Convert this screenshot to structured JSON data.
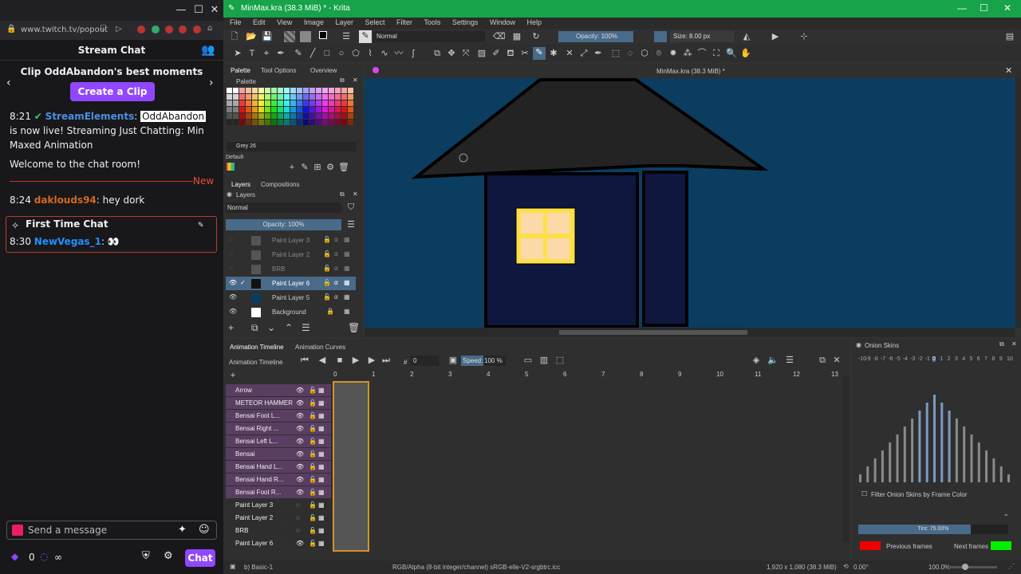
{
  "twitch": {
    "url": "www.twitch.tv/popout",
    "header": "Stream Chat",
    "clip_title": "Clip OddAbandon's best moments",
    "clip_button": "Create a Clip",
    "messages": [
      {
        "time": "8:21",
        "user": "StreamElements",
        "sep": ":",
        "mention": "OddAbandon",
        "text": "is now live! Streaming Just Chatting: Min Maxed Animation"
      },
      {
        "text": "Welcome to the chat room!"
      },
      {
        "time": "8:24",
        "user": "daklouds94",
        "text": ": hey dork"
      },
      {
        "time": "8:30",
        "user": "NewVegas_1",
        "text": ":",
        "emote": "👀"
      }
    ],
    "new_label": "New",
    "first_time": "First Time Chat",
    "input_placeholder": "Send a message",
    "points": "0",
    "chat_button": "Chat"
  },
  "krita": {
    "title": "MinMax.kra (38.3 MiB) * - Krita",
    "menu": [
      "File",
      "Edit",
      "View",
      "Image",
      "Layer",
      "Select",
      "Filter",
      "Tools",
      "Settings",
      "Window",
      "Help"
    ],
    "blend_mode": "Normal",
    "opacity": "Opacity: 100%",
    "size": "Size: 8.00 px",
    "doc_tab": "MinMax.kra (38.3 MiB) *",
    "docker_tabs": [
      "Palette",
      "Tool Options",
      "Overview"
    ],
    "palette_label": "Palette",
    "color_name": "Grey 26",
    "palette_default": "Default",
    "layers_tabs": [
      "Layers",
      "Compositions"
    ],
    "layer_mode": "Normal",
    "layer_opacity": "Opacity: 100%",
    "layers": [
      "Paint Layer 3",
      "Paint Layer 2",
      "BRB",
      "Paint Layer 6",
      "Paint Layer 5",
      "Background"
    ],
    "anim_tabs": [
      "Animation Timeline",
      "Animation Curves"
    ],
    "anim_title": "Animation Timeline",
    "frame": "0",
    "speed_label": "Speed:",
    "speed": "100 %",
    "frame_numbers": [
      "0",
      "1",
      "2",
      "3",
      "4",
      "5",
      "6",
      "7",
      "8",
      "9",
      "10",
      "11",
      "12",
      "13"
    ],
    "tl_layers": [
      "Arrow",
      "METEOR HAMMER",
      "Bensai Foot L...",
      "Bensai Right ...",
      "Bensai Left L...",
      "Bensai",
      "Bensai Hand L...",
      "Bensai Hand R...",
      "Bensai Foot R...",
      "Paint Layer 3",
      "Paint Layer 2",
      "BRB",
      "Paint Layer 6"
    ],
    "onion_title": "Onion Skins",
    "onion_numbers": [
      "-10",
      "-9",
      "-8",
      "-7",
      "-6",
      "-5",
      "-4",
      "-3",
      "-2",
      "-1",
      "0",
      "1",
      "2",
      "3",
      "4",
      "5",
      "6",
      "7",
      "8",
      "9",
      "10"
    ],
    "onion_filter": "Filter Onion Skins by Frame Color",
    "tint": "Tint: 75.00%",
    "prev_frames": "Previous frames",
    "next_frames": "Next frames",
    "status_brush": "b) Basic-1",
    "status_color": "RGB/Alpha (8-bit integer/channel)  sRGB-elle-V2-srgbtrc.icc",
    "status_size": "1,920 x 1,080 (38.3 MiB)",
    "status_angle": "0.00°",
    "status_zoom": "100.0%"
  }
}
